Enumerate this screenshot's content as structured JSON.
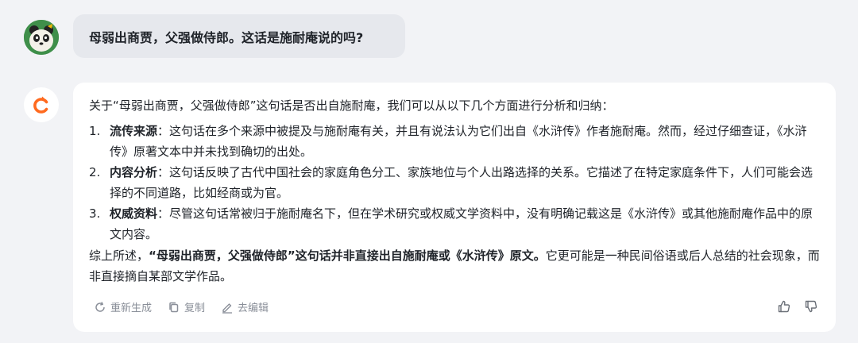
{
  "user_message": "母弱出商贾，父强做侍郎。这话是施耐庵说的吗?",
  "bot": {
    "intro": "关于“母弱出商贾，父强做侍郎”这句话是否出自施耐庵，我们可以从以下几个方面进行分析和归纳：",
    "points": [
      {
        "num": "1.",
        "title": "流传来源",
        "text": "：这句话在多个来源中被提及与施耐庵有关，并且有说法认为它们出自《水浒传》作者施耐庵。然而，经过仔细查证，《水浒传》原著文本中并未找到确切的出处。"
      },
      {
        "num": "2.",
        "title": "内容分析",
        "text": "：这句话反映了古代中国社会的家庭角色分工、家族地位与个人出路选择的关系。它描述了在特定家庭条件下，人们可能会选择的不同道路，比如经商或为官。"
      },
      {
        "num": "3.",
        "title": "权威资料",
        "text": "：尽管这句话常被归于施耐庵名下，但在学术研究或权威文学资料中，没有明确记载这是《水浒传》或其他施耐庵作品中的原文内容。"
      }
    ],
    "summary_prefix": "综上所述，",
    "summary_bold": "“母弱出商贾，父强做侍郎”这句话并非直接出自施耐庵或《水浒传》原文。",
    "summary_rest": "它更可能是一种民间俗语或后人总结的社会现象，而非直接摘自某部文学作品。"
  },
  "actions": {
    "regenerate": "重新生成",
    "copy": "复制",
    "edit": "去编辑"
  },
  "icons": {
    "user_avatar": "panda-avatar-icon",
    "bot_avatar": "c-logo-icon",
    "regenerate": "refresh-icon",
    "copy": "copy-icon",
    "edit": "pencil-icon",
    "like": "thumbs-up-icon",
    "dislike": "thumbs-down-icon"
  },
  "colors": {
    "background": "#f2f3f6",
    "user_bubble": "#e6e8ed",
    "bot_logo": "#ff6a1f",
    "muted": "#8a8f99"
  }
}
